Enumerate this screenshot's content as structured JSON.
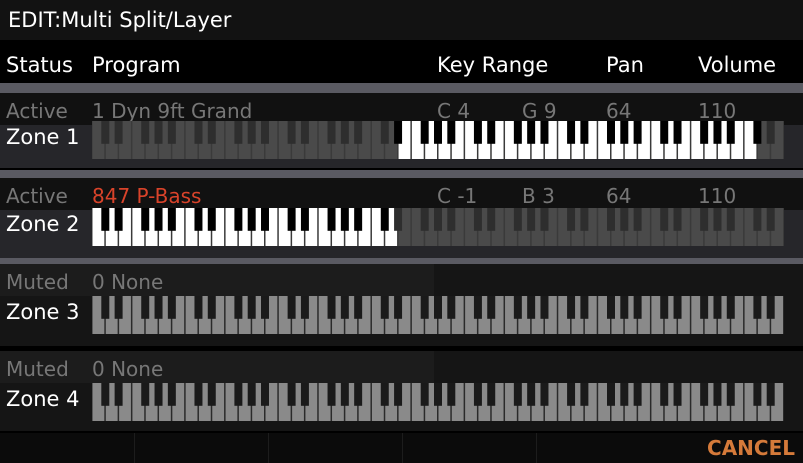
{
  "title": "EDIT:Multi Split/Layer",
  "columns": {
    "status": "Status",
    "program": "Program",
    "key_range": "Key Range",
    "pan": "Pan",
    "volume": "Volume"
  },
  "zones": [
    {
      "status": "Active",
      "program": "1 Dyn 9ft Grand",
      "key_lo": "C 4",
      "key_hi": "G 9",
      "pan": "64",
      "volume": "110",
      "label": "Zone 1",
      "range_start": 0.44,
      "range_end": 0.97,
      "program_highlight": false
    },
    {
      "status": "Active",
      "program": "847 P-Bass",
      "key_lo": "C -1",
      "key_hi": "B 3",
      "pan": "64",
      "volume": "110",
      "label": "Zone 2",
      "range_start": 0.0,
      "range_end": 0.44,
      "program_highlight": true
    },
    {
      "status": "Muted",
      "program": "0 None",
      "label": "Zone 3"
    },
    {
      "status": "Muted",
      "program": "0 None",
      "label": "Zone 4"
    }
  ],
  "softkeys": {
    "cancel": "CANCEL"
  },
  "colors": {
    "program_highlight": "#d9432a",
    "cancel": "#d57a3a",
    "active_keys": "#ffffff",
    "inactive_keys": "#6e6e6e"
  }
}
